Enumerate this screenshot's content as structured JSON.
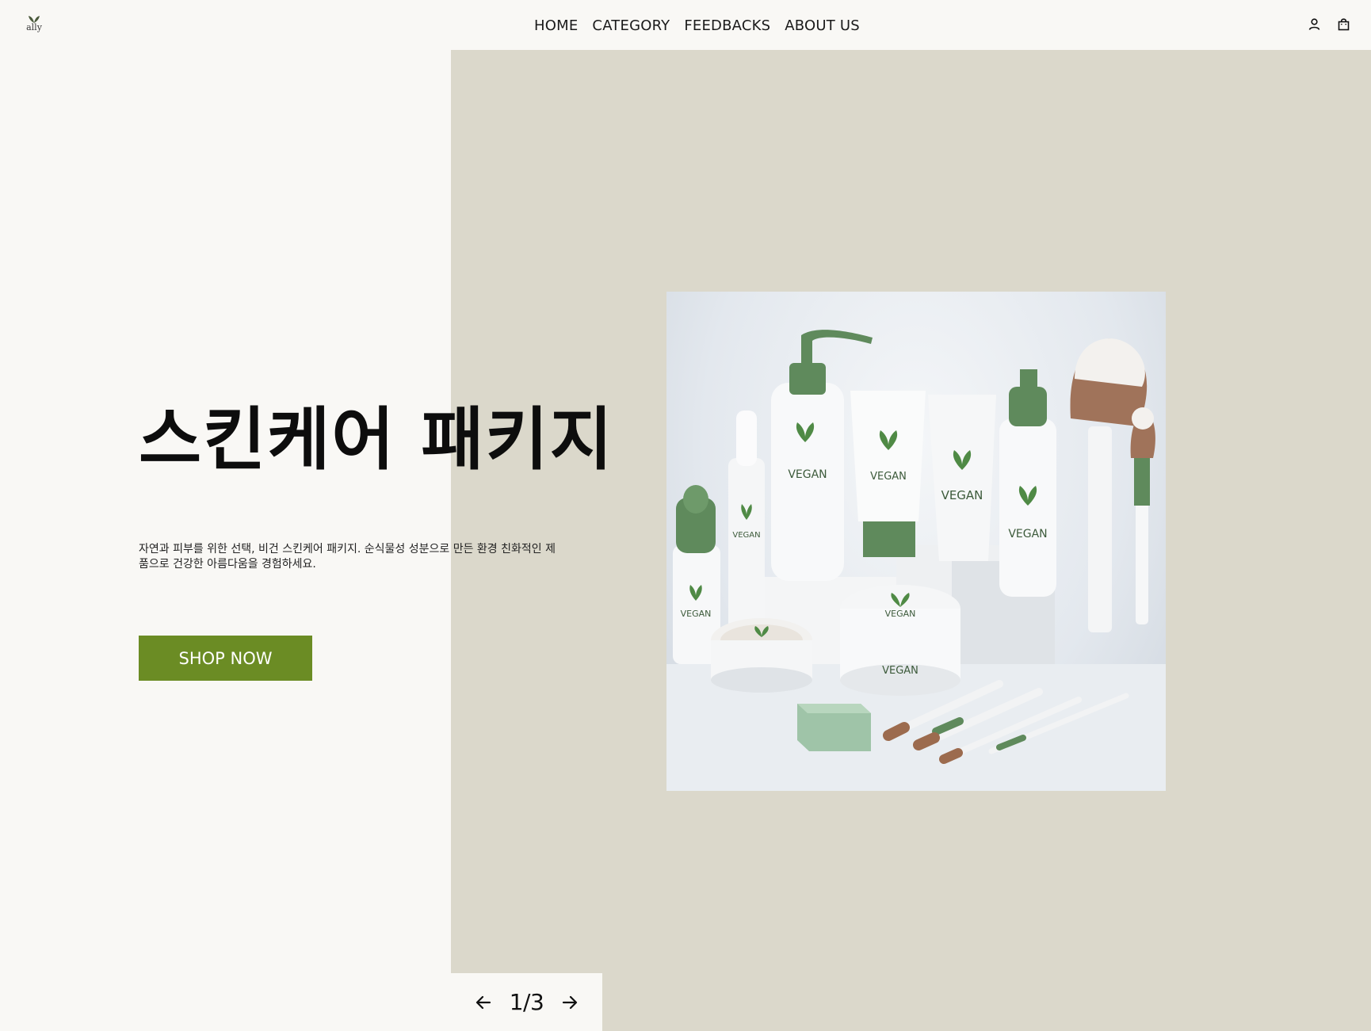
{
  "header": {
    "logo_text": "ally",
    "nav": [
      {
        "label": "HOME"
      },
      {
        "label": "CATEGORY"
      },
      {
        "label": "FEEDBACKS"
      },
      {
        "label": "ABOUT US"
      }
    ],
    "icons": [
      "user-icon",
      "shopping-bag-icon"
    ]
  },
  "hero": {
    "title": "스킨케어 패키지",
    "description": "자연과 피부를 위한 선택, 비건 스킨케어 패키지. 순식물성 성분으로 만든 환경 친화적인 제품으로 건강한 아름다움을 경험하세요.",
    "cta_label": "SHOP NOW",
    "product_label": "VEGAN"
  },
  "slider": {
    "counter": "1/3",
    "current": 1,
    "total": 3
  },
  "colors": {
    "page_bg": "#f9f8f5",
    "panel_bg": "#dbd8cb",
    "accent": "#6b8c24",
    "product_green": "#5f8a5c"
  }
}
